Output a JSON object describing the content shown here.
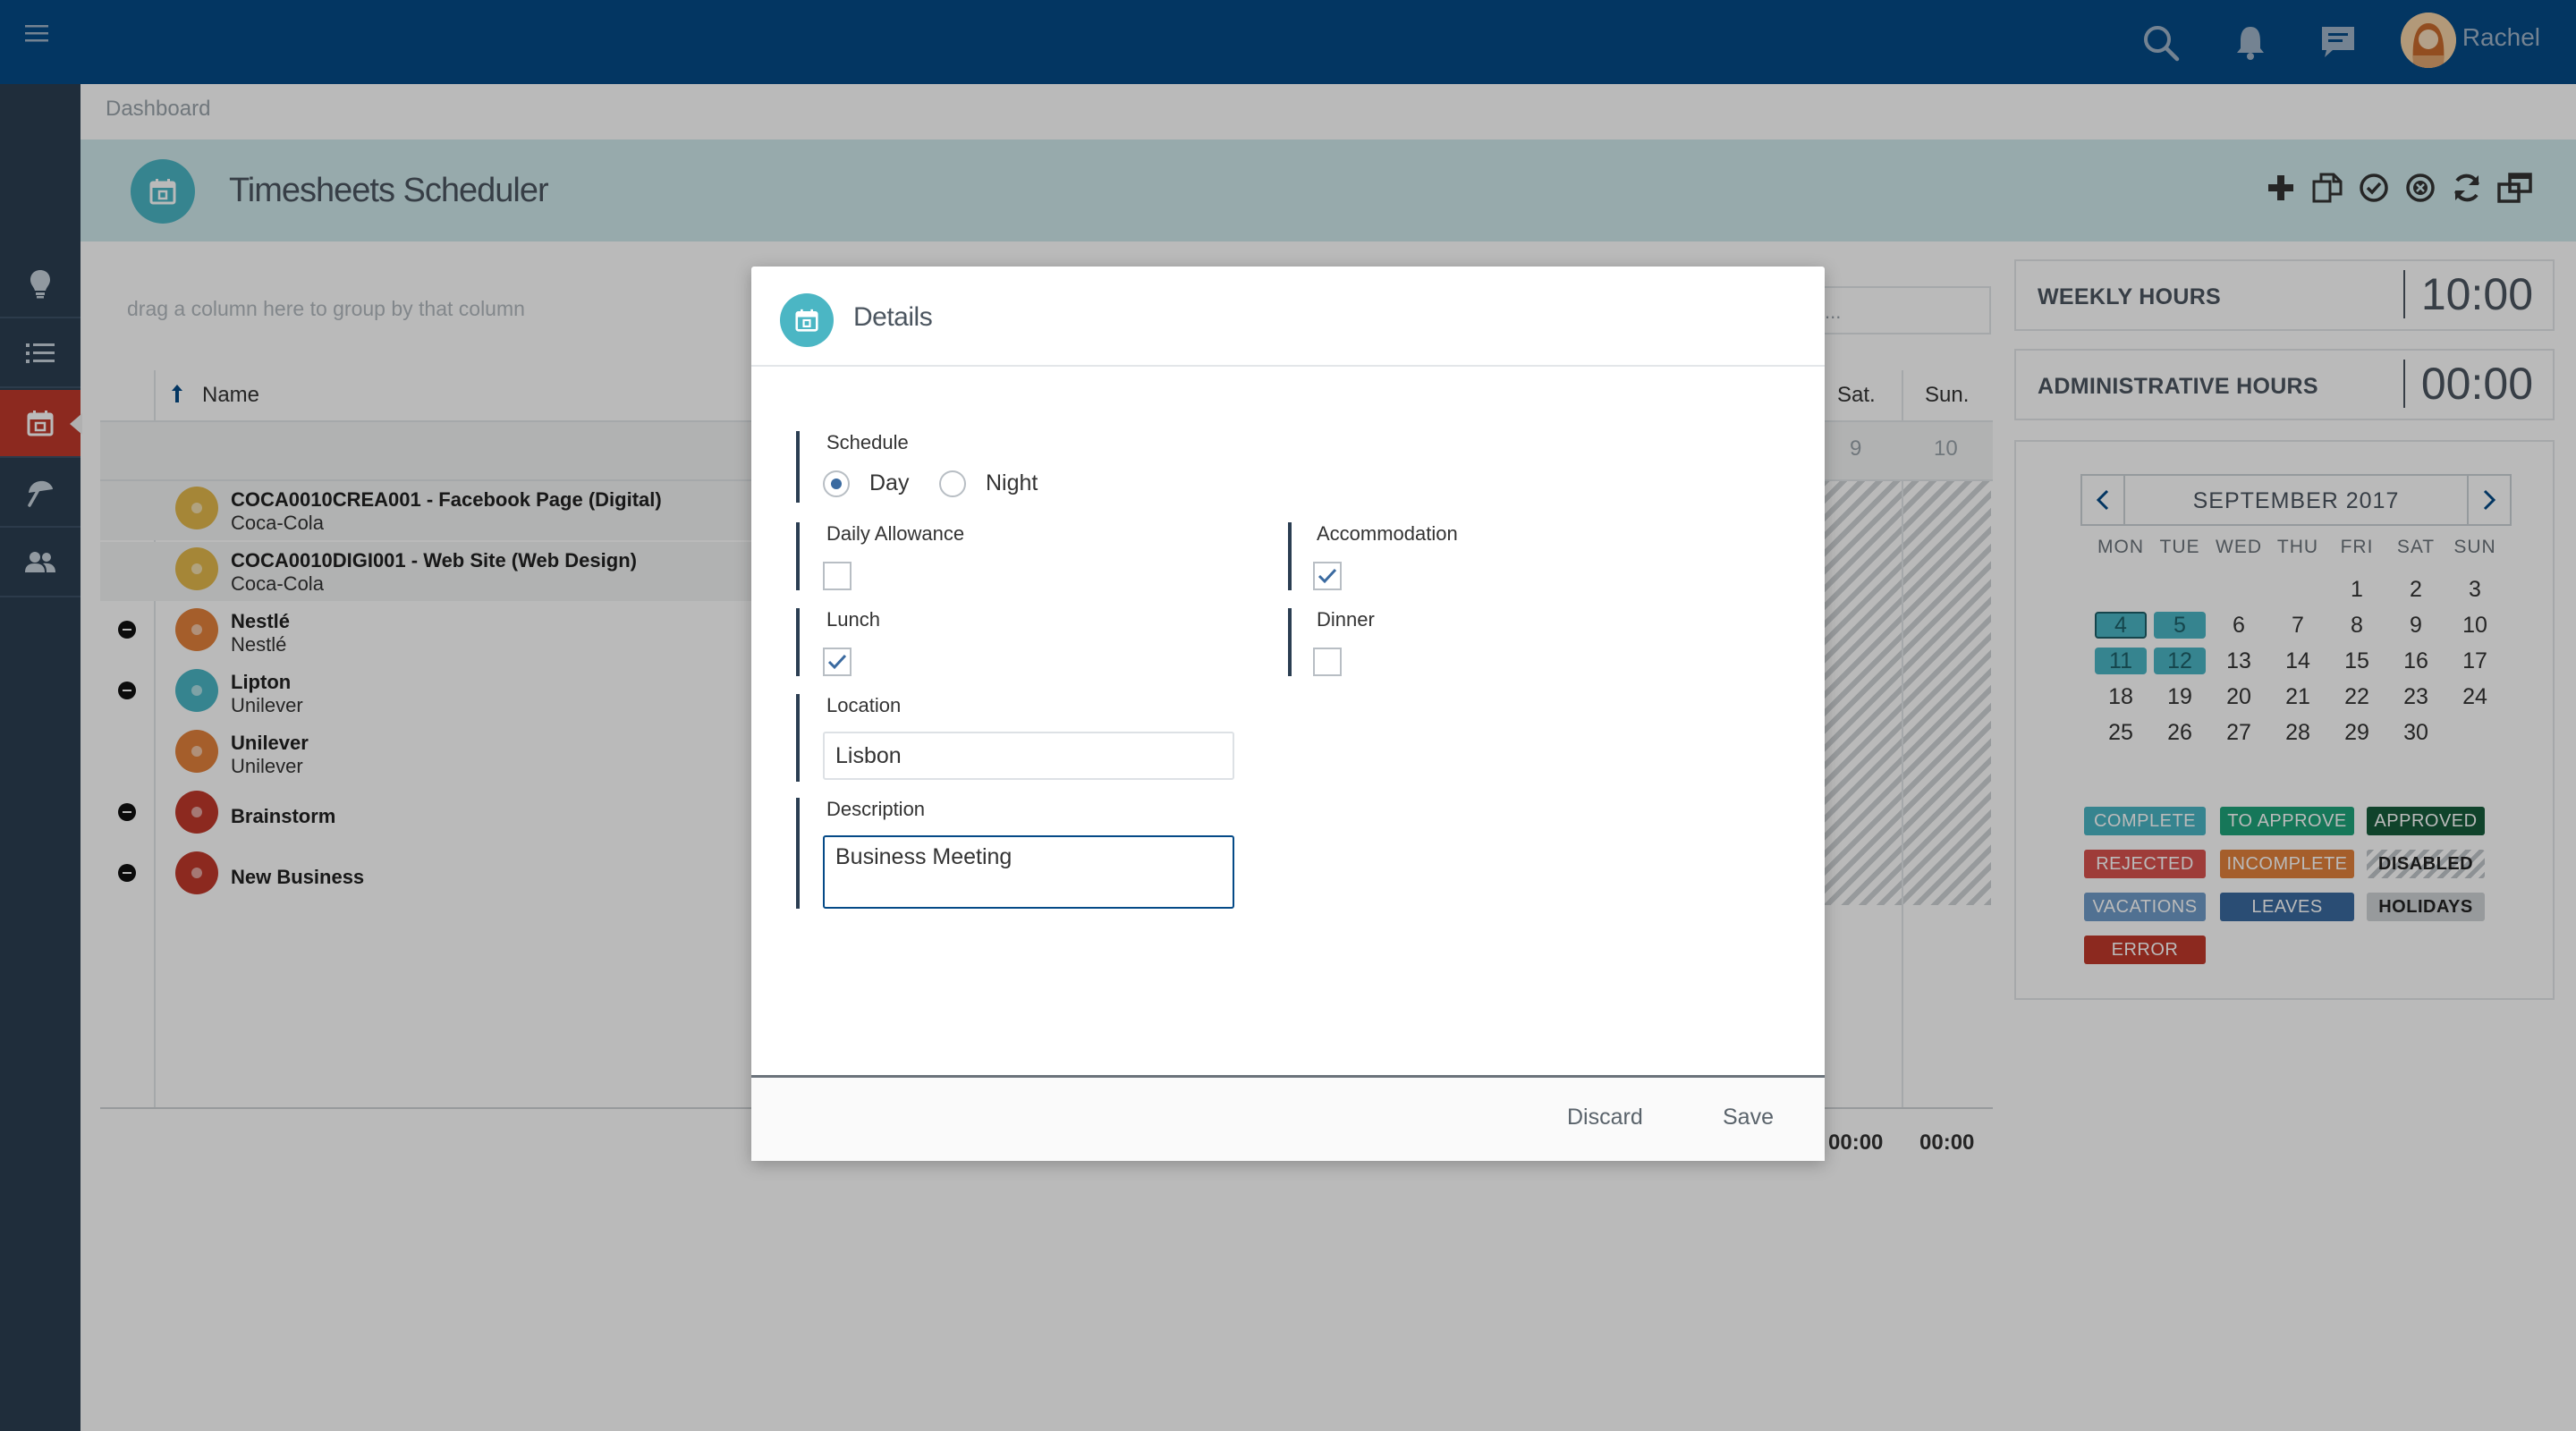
{
  "topbar": {
    "user_name": "Rachel"
  },
  "breadcrumb": "Dashboard",
  "page": {
    "title": "Timesheets Scheduler"
  },
  "grid": {
    "group_hint": "drag a column here to group by that column",
    "name_header": "Name",
    "sat_header": "Sat.",
    "sun_header": "Sun.",
    "sat_num": "9",
    "sun_num": "10",
    "search_placeholder": "...",
    "totals": [
      "00:00",
      "00:00"
    ],
    "rows": [
      {
        "name": "COCA0010CREA001 - Facebook Page (Digital)",
        "client": "Coca-Cola",
        "icon_color": "#e3b84c",
        "collapsible": false
      },
      {
        "name": "COCA0010DIGI001 - Web Site (Web Design)",
        "client": "Coca-Cola",
        "icon_color": "#e3b84c",
        "collapsible": false
      },
      {
        "name": "Nestlé",
        "client": "Nestlé",
        "icon_color": "#e2823b",
        "collapsible": true
      },
      {
        "name": "Lipton",
        "client": "Unilever",
        "icon_color": "#4bb6c4",
        "collapsible": true
      },
      {
        "name": "Unilever",
        "client": "Unilever",
        "icon_color": "#e2823b",
        "collapsible": false
      },
      {
        "name": "Brainstorm",
        "client": "",
        "icon_color": "#c0392b",
        "collapsible": true
      },
      {
        "name": "New Business",
        "client": "",
        "icon_color": "#c0392b",
        "collapsible": true
      }
    ]
  },
  "summary": {
    "weekly_label": "WEEKLY HOURS",
    "weekly_value": "10:00",
    "admin_label": "ADMINISTRATIVE HOURS",
    "admin_value": "00:00"
  },
  "calendar": {
    "month": "SEPTEMBER 2017",
    "weekdays": [
      "MON",
      "TUE",
      "WED",
      "THU",
      "FRI",
      "SAT",
      "SUN"
    ],
    "weeks": [
      [
        "",
        "",
        "",
        "",
        "1",
        "2",
        "3"
      ],
      [
        "4",
        "5",
        "6",
        "7",
        "8",
        "9",
        "10"
      ],
      [
        "11",
        "12",
        "13",
        "14",
        "15",
        "16",
        "17"
      ],
      [
        "18",
        "19",
        "20",
        "21",
        "22",
        "23",
        "24"
      ],
      [
        "25",
        "26",
        "27",
        "28",
        "29",
        "30",
        ""
      ]
    ],
    "highlighted": [
      "4",
      "5",
      "11",
      "12"
    ],
    "selected": "4"
  },
  "legend": [
    {
      "label": "COMPLETE",
      "color": "#4bb6c4"
    },
    {
      "label": "TO APPROVE",
      "color": "#1fa37a"
    },
    {
      "label": "APPROVED",
      "color": "#175c3b"
    },
    {
      "label": "REJECTED",
      "color": "#d9534f"
    },
    {
      "label": "INCOMPLETE",
      "color": "#e2823b"
    },
    {
      "label": "DISABLED",
      "color": "hatched"
    },
    {
      "label": "VACATIONS",
      "color": "#6f9bc8"
    },
    {
      "label": "LEAVES",
      "color": "#3a6aa0"
    },
    {
      "label": "HOLIDAYS",
      "color": "#d0d3d6"
    },
    {
      "label": "ERROR",
      "color": "#c0392b"
    }
  ],
  "modal": {
    "title": "Details",
    "schedule_label": "Schedule",
    "schedule_options": [
      "Day",
      "Night"
    ],
    "schedule_value": "Day",
    "daily_allowance_label": "Daily Allowance",
    "daily_allowance_checked": false,
    "accommodation_label": "Accommodation",
    "accommodation_checked": true,
    "lunch_label": "Lunch",
    "lunch_checked": true,
    "dinner_label": "Dinner",
    "dinner_checked": false,
    "location_label": "Location",
    "location_value": "Lisbon",
    "description_label": "Description",
    "description_value": "Business Meeting",
    "discard_label": "Discard",
    "save_label": "Save"
  },
  "colors": {
    "topbar": "#054a87",
    "sidebar": "#2b3e52",
    "accent_red": "#c0392b",
    "teal": "#4bb6c4"
  },
  "icons": {
    "topbar": [
      "hamburger-icon",
      "search-icon",
      "bell-icon",
      "chat-icon"
    ],
    "sidebar": [
      "lightbulb-icon",
      "list-icon",
      "calendar-icon",
      "umbrella-icon",
      "users-icon"
    ],
    "toolbar": [
      "plus-icon",
      "copy-icon",
      "check-circle-icon",
      "x-circle-icon",
      "refresh-icon",
      "windows-icon"
    ]
  }
}
